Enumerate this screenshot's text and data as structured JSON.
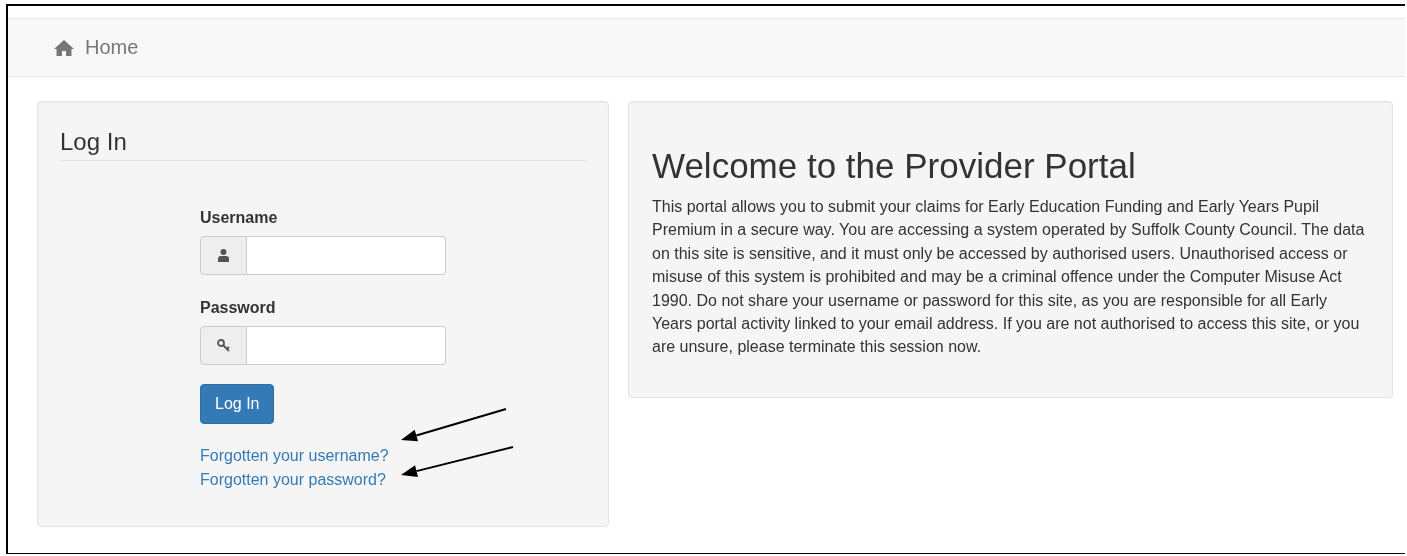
{
  "navbar": {
    "home": "Home"
  },
  "login": {
    "title": "Log In",
    "fields": [
      {
        "label": "Username",
        "kind": "user"
      },
      {
        "label": "Password",
        "kind": "key"
      }
    ],
    "button": "Log In",
    "links": [
      "Forgotten your username?",
      "Forgotten your password?"
    ]
  },
  "welcome": {
    "heading": "Welcome to the Provider Portal",
    "text": "This portal allows you to submit your claims for Early Education Funding and Early Years Pupil Premium in a secure way. You are accessing a system operated by Suffolk County Council. The data on this site is sensitive, and it must only be accessed by authorised users. Unauthorised access or misuse of this system is prohibited and may be a criminal offence under the Computer Misuse Act 1990. Do not share your username or password for this site, as you are responsible for all Early Years portal activity linked to your email address. If you are not authorised to access this site, or you are unsure, please terminate this session now."
  }
}
